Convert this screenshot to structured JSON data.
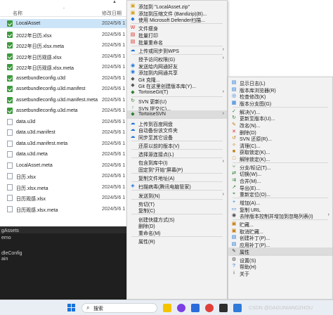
{
  "explorer": {
    "col_name": "名称",
    "col_date": "修改日期",
    "files": [
      {
        "name": "LocalAsset",
        "date": "2024/5/6 1",
        "kind": "asset",
        "selected": true
      },
      {
        "name": "2022年日历.xlsx",
        "date": "2024/5/6 1",
        "kind": "asset"
      },
      {
        "name": "2022年日历.xlsx.meta",
        "date": "2024/5/6 1",
        "kind": "asset"
      },
      {
        "name": "2022年日历观感.xlsx",
        "date": "2024/5/6 1",
        "kind": "asset"
      },
      {
        "name": "2022年日历观感.xlsx.meta",
        "date": "2024/5/6 1",
        "kind": "asset"
      },
      {
        "name": "assetbundleconfig.u3d",
        "date": "2024/5/6 1",
        "kind": "asset"
      },
      {
        "name": "assetbundleconfig.u3d.manifest",
        "date": "2024/5/6 1",
        "kind": "asset"
      },
      {
        "name": "assetbundleconfig.u3d.manifest.meta",
        "date": "2024/5/6 1",
        "kind": "asset"
      },
      {
        "name": "assetbundleconfig.u3d.meta",
        "date": "2024/5/6 1",
        "kind": "asset"
      },
      {
        "name": "data.u3d",
        "date": "2024/5/6 1",
        "kind": "doc"
      },
      {
        "name": "data.u3d.manifest",
        "date": "2024/5/6 1",
        "kind": "doc"
      },
      {
        "name": "data.u3d.manifest.meta",
        "date": "2024/5/6 1",
        "kind": "doc"
      },
      {
        "name": "data.u3d.meta",
        "date": "2024/5/6 1",
        "kind": "doc"
      },
      {
        "name": "LocalAsset.meta",
        "date": "2024/5/6 1",
        "kind": "doc"
      },
      {
        "name": "日历.xlsx",
        "date": "2024/5/6 1",
        "kind": "doc"
      },
      {
        "name": "日历.xlsx.meta",
        "date": "2024/5/6 1",
        "kind": "doc"
      },
      {
        "name": "日历观感.xlsx",
        "date": "2024/5/6 1",
        "kind": "doc"
      },
      {
        "name": "日历观感.xlsx.meta",
        "date": "2024/5/6 1",
        "kind": "doc"
      }
    ]
  },
  "dark_panel": {
    "lines": [
      "gAssets",
      "emo",
      "dleConfig",
      "ain"
    ]
  },
  "main_menu": {
    "items": [
      {
        "label": "添加到 \"LocalAsset.zip\"",
        "icon": "zip-icon",
        "glyph": "▣",
        "color": "#d4a017"
      },
      {
        "label": "添加到压缩文件 (Bandizip)(B)...",
        "icon": "zip-icon",
        "glyph": "▣",
        "color": "#d4a017"
      },
      {
        "label": "使用 Microsoft Defender扫描...",
        "icon": "shield-icon",
        "glyph": "◆",
        "color": "#1a73d9"
      },
      {
        "sep": true
      },
      {
        "label": "文件瘦身",
        "icon": "wps-icon",
        "glyph": "W",
        "color": "#d93025"
      },
      {
        "label": "批量打印",
        "icon": "print-icon",
        "glyph": "▤",
        "color": "#d93025"
      },
      {
        "label": "批量重命名",
        "icon": "rename-icon",
        "glyph": "▤",
        "color": "#d93025"
      },
      {
        "sep": true
      },
      {
        "label": "上传或同步到WPS",
        "icon": "cloud-icon",
        "glyph": "☁",
        "color": "#1a73d9",
        "arrow": true
      },
      {
        "sep": true
      },
      {
        "label": "授予访问权限(G)",
        "icon": "",
        "glyph": "",
        "color": "#444",
        "arrow": true
      },
      {
        "label": "发送给内网通好友",
        "icon": "send-icon",
        "glyph": "◉",
        "color": "#1a73d9"
      },
      {
        "label": "添加到内网通共享",
        "icon": "share-icon",
        "glyph": "◉",
        "color": "#1a73d9"
      },
      {
        "label": "Git 克隆...",
        "icon": "git-icon",
        "glyph": "◆",
        "color": "#555"
      },
      {
        "label": "Git 在这里创建版本库(Y)...",
        "icon": "git-icon",
        "glyph": "◆",
        "color": "#555"
      },
      {
        "label": "TortoiseGit(T)",
        "icon": "tortoisegit-icon",
        "glyph": "◆",
        "color": "#2e7d32",
        "arrow": true
      },
      {
        "sep": true
      },
      {
        "label": "SVN 更新(U)",
        "icon": "svn-update-icon",
        "glyph": "↻",
        "color": "#2e7d32"
      },
      {
        "label": "SVN 提交(C)...",
        "icon": "svn-commit-icon",
        "glyph": "↑",
        "color": "#2e7d32"
      },
      {
        "label": "TortoiseSVN",
        "icon": "tortoisesvn-icon",
        "glyph": "◆",
        "color": "#2e7d32",
        "arrow": true,
        "hover": true
      },
      {
        "sep": true
      },
      {
        "label": "上传到百度网盘",
        "icon": "baidu-icon",
        "glyph": "☁",
        "color": "#1a73d9"
      },
      {
        "label": "自动备份该文件夹",
        "icon": "baidu-icon",
        "glyph": "☁",
        "color": "#1a73d9"
      },
      {
        "label": "同步至其它设备",
        "icon": "baidu-icon",
        "glyph": "☁",
        "color": "#1a73d9"
      },
      {
        "sep": true
      },
      {
        "label": "还原以前的版本(V)",
        "icon": "",
        "glyph": "",
        "color": "#444"
      },
      {
        "sep": true
      },
      {
        "label": "选择源连接点(L)",
        "icon": "",
        "glyph": "",
        "color": "#444"
      },
      {
        "sep": true
      },
      {
        "label": "包含到库中(I)",
        "icon": "",
        "glyph": "",
        "color": "#444",
        "arrow": true
      },
      {
        "label": "固定到\"开始\"屏幕(P)",
        "icon": "",
        "glyph": "",
        "color": "#444"
      },
      {
        "sep": true
      },
      {
        "label": "复制文件地址(A)",
        "icon": "",
        "glyph": "",
        "color": "#444"
      },
      {
        "sep": true
      },
      {
        "label": "扫描病毒(腾讯电脑管家)",
        "icon": "tencent-icon",
        "glyph": "◈",
        "color": "#1a73d9"
      },
      {
        "sep": true
      },
      {
        "label": "发送到(N)",
        "icon": "",
        "glyph": "",
        "color": "#444",
        "arrow": true
      },
      {
        "sep": true
      },
      {
        "label": "剪切(T)",
        "icon": "",
        "glyph": "",
        "color": "#444"
      },
      {
        "label": "复制(C)",
        "icon": "",
        "glyph": "",
        "color": "#444"
      },
      {
        "sep": true
      },
      {
        "label": "创建快捷方式(S)",
        "icon": "",
        "glyph": "",
        "color": "#444"
      },
      {
        "label": "删除(D)",
        "icon": "",
        "glyph": "",
        "color": "#444"
      },
      {
        "label": "重命名(M)",
        "icon": "",
        "glyph": "",
        "color": "#444"
      },
      {
        "sep": true
      },
      {
        "label": "属性(R)",
        "icon": "",
        "glyph": "",
        "color": "#444"
      }
    ]
  },
  "svn_menu": {
    "items": [
      {
        "label": "显示日志(L)",
        "icon": "log-icon",
        "glyph": "▤",
        "color": "#1a73d9"
      },
      {
        "label": "版本库浏览器(R)",
        "icon": "repo-browser-icon",
        "glyph": "▤",
        "color": "#1a73d9"
      },
      {
        "label": "检查修改(K)",
        "icon": "check-icon",
        "glyph": "◎",
        "color": "#1a73d9"
      },
      {
        "label": "版本分支图(G)",
        "icon": "graph-icon",
        "glyph": "▦",
        "color": "#1a73d9"
      },
      {
        "sep": true
      },
      {
        "label": "解决(V)...",
        "icon": "resolve-icon",
        "glyph": "✓",
        "color": "#2e7d32"
      },
      {
        "label": "更新至版本(U)...",
        "icon": "update-icon",
        "glyph": "↻",
        "color": "#2e7d32"
      },
      {
        "label": "改名(N)...",
        "icon": "rename-icon",
        "glyph": "✎",
        "color": "#c27c0e"
      },
      {
        "label": "删除(D)",
        "icon": "delete-icon",
        "glyph": "✕",
        "color": "#d93025"
      },
      {
        "label": "SVN 还原(R)...",
        "icon": "revert-icon",
        "glyph": "↺",
        "color": "#c27c0e"
      },
      {
        "label": "清理(C)...",
        "icon": "cleanup-icon",
        "glyph": "✧",
        "color": "#c27c0e"
      },
      {
        "label": "获取锁定(K)...",
        "icon": "lock-icon",
        "glyph": "■",
        "color": "#c27c0e"
      },
      {
        "label": "解除锁定(K)...",
        "icon": "unlock-icon",
        "glyph": "□",
        "color": "#c27c0e"
      },
      {
        "sep": true
      },
      {
        "label": "分支/标记(T)...",
        "icon": "branch-icon",
        "glyph": "⑂",
        "color": "#2e7d32"
      },
      {
        "label": "切换(W)...",
        "icon": "switch-icon",
        "glyph": "⇄",
        "color": "#2e7d32"
      },
      {
        "label": "合并(M)...",
        "icon": "merge-icon",
        "glyph": "⇉",
        "color": "#2e7d32"
      },
      {
        "label": "导出(E)...",
        "icon": "export-icon",
        "glyph": "↗",
        "color": "#2e7d32"
      },
      {
        "label": "重新定位(O)...",
        "icon": "relocate-icon",
        "glyph": "⌖",
        "color": "#2e7d32"
      },
      {
        "sep": true
      },
      {
        "label": "增加(A)...",
        "icon": "add-icon",
        "glyph": "+",
        "color": "#1a73d9"
      },
      {
        "label": "复制 URL",
        "icon": "copy-url-icon",
        "glyph": "▭",
        "color": "#1a73d9"
      },
      {
        "label": "去除版本控制并增加到忽略列表(I)",
        "icon": "ignore-icon",
        "glyph": "◉",
        "color": "#444",
        "arrow": true
      },
      {
        "sep": true
      },
      {
        "label": "贮藏...",
        "icon": "shelve-icon",
        "glyph": "▣",
        "color": "#c27c0e"
      },
      {
        "label": "取消贮藏...",
        "icon": "unshelve-icon",
        "glyph": "▣",
        "color": "#c27c0e"
      },
      {
        "label": "创建补丁(P)...",
        "icon": "create-patch-icon",
        "glyph": "▤",
        "color": "#1a73d9"
      },
      {
        "label": "应用补丁(P)...",
        "icon": "apply-patch-icon",
        "glyph": "▤",
        "color": "#1a73d9"
      },
      {
        "label": "属性",
        "icon": "properties-icon",
        "glyph": "✎",
        "color": "#444",
        "hover": true
      },
      {
        "sep": true
      },
      {
        "label": "设置(S)",
        "icon": "settings-icon",
        "glyph": "⚙",
        "color": "#444"
      },
      {
        "label": "帮助(H)",
        "icon": "help-icon",
        "glyph": "?",
        "color": "#1a73d9"
      },
      {
        "label": "关于",
        "icon": "about-icon",
        "glyph": "i",
        "color": "#444"
      }
    ]
  },
  "taskbar": {
    "search_label": "搜索"
  },
  "watermark": "CSDN @DAGUNIANGZHOU"
}
